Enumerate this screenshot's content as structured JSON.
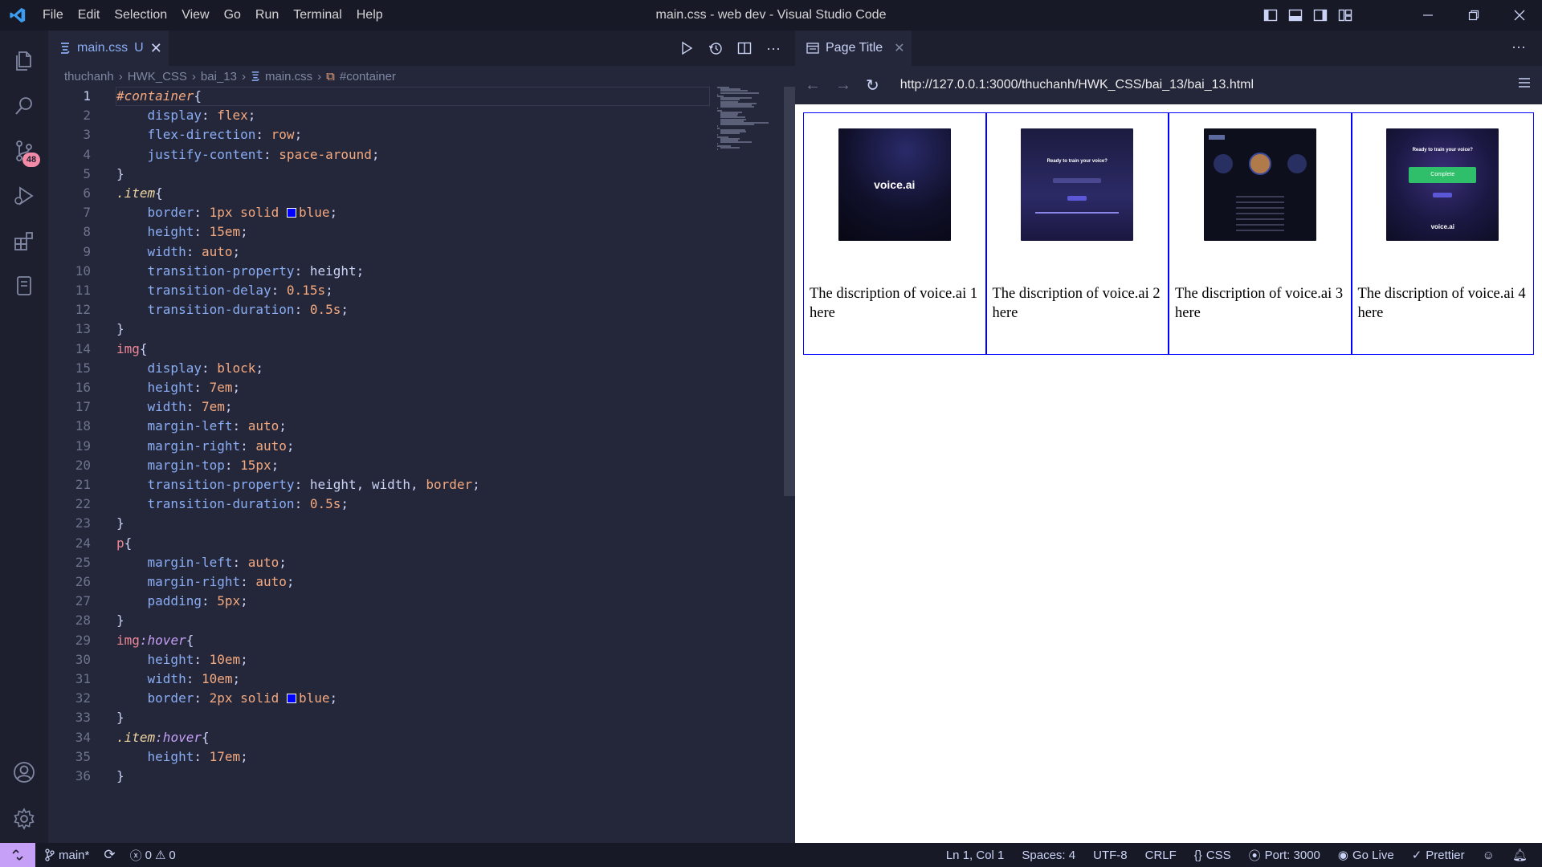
{
  "window": {
    "title": "main.css - web dev - Visual Studio Code",
    "menu": [
      "File",
      "Edit",
      "Selection",
      "View",
      "Go",
      "Run",
      "Terminal",
      "Help"
    ]
  },
  "activity_bar": {
    "source_control_badge": "48"
  },
  "editor": {
    "tab": {
      "name": "main.css",
      "status": "U",
      "close": "✕"
    },
    "breadcrumb": [
      "thuchanh",
      "HWK_CSS",
      "bai_13",
      "main.css",
      "#container"
    ],
    "lines": [
      [
        [
          "t-id",
          "#container"
        ],
        [
          "t-br",
          "{"
        ]
      ],
      [
        [
          "",
          "    "
        ],
        [
          "t-prop",
          "display"
        ],
        [
          "",
          ": "
        ],
        [
          "t-val",
          "flex"
        ],
        [
          "",
          ";"
        ]
      ],
      [
        [
          "",
          "    "
        ],
        [
          "t-prop",
          "flex-direction"
        ],
        [
          "",
          ": "
        ],
        [
          "t-val",
          "row"
        ],
        [
          "",
          ";"
        ]
      ],
      [
        [
          "",
          "    "
        ],
        [
          "t-prop",
          "justify-content"
        ],
        [
          "",
          ": "
        ],
        [
          "t-val",
          "space-around"
        ],
        [
          "",
          ";"
        ]
      ],
      [
        [
          "t-br",
          "}"
        ]
      ],
      [
        [
          "t-cls",
          ".item"
        ],
        [
          "t-br",
          "{"
        ]
      ],
      [
        [
          "",
          "    "
        ],
        [
          "t-prop",
          "border"
        ],
        [
          "",
          ": "
        ],
        [
          "t-num",
          "1px"
        ],
        [
          "",
          " "
        ],
        [
          "t-val",
          "solid"
        ],
        [
          "",
          " "
        ],
        [
          "swatch",
          ""
        ],
        [
          "t-val",
          "blue"
        ],
        [
          "",
          ";"
        ]
      ],
      [
        [
          "",
          "    "
        ],
        [
          "t-prop",
          "height"
        ],
        [
          "",
          ": "
        ],
        [
          "t-num",
          "15em"
        ],
        [
          "",
          ";"
        ]
      ],
      [
        [
          "",
          "    "
        ],
        [
          "t-prop",
          "width"
        ],
        [
          "",
          ": "
        ],
        [
          "t-val",
          "auto"
        ],
        [
          "",
          ";"
        ]
      ],
      [
        [
          "",
          "    "
        ],
        [
          "t-prop",
          "transition-property"
        ],
        [
          "",
          ": "
        ],
        [
          "",
          "height"
        ],
        [
          "",
          ";"
        ]
      ],
      [
        [
          "",
          "    "
        ],
        [
          "t-prop",
          "transition-delay"
        ],
        [
          "",
          ": "
        ],
        [
          "t-num",
          "0.15s"
        ],
        [
          "",
          ";"
        ]
      ],
      [
        [
          "",
          "    "
        ],
        [
          "t-prop",
          "transition-duration"
        ],
        [
          "",
          ": "
        ],
        [
          "t-num",
          "0.5s"
        ],
        [
          "",
          ";"
        ]
      ],
      [
        [
          "t-br",
          "}"
        ]
      ],
      [
        [
          "t-tag",
          "img"
        ],
        [
          "t-br",
          "{"
        ]
      ],
      [
        [
          "",
          "    "
        ],
        [
          "t-prop",
          "display"
        ],
        [
          "",
          ": "
        ],
        [
          "t-val",
          "block"
        ],
        [
          "",
          ";"
        ]
      ],
      [
        [
          "",
          "    "
        ],
        [
          "t-prop",
          "height"
        ],
        [
          "",
          ": "
        ],
        [
          "t-num",
          "7em"
        ],
        [
          "",
          ";"
        ]
      ],
      [
        [
          "",
          "    "
        ],
        [
          "t-prop",
          "width"
        ],
        [
          "",
          ": "
        ],
        [
          "t-num",
          "7em"
        ],
        [
          "",
          ";"
        ]
      ],
      [
        [
          "",
          "    "
        ],
        [
          "t-prop",
          "margin-left"
        ],
        [
          "",
          ": "
        ],
        [
          "t-val",
          "auto"
        ],
        [
          "",
          ";"
        ]
      ],
      [
        [
          "",
          "    "
        ],
        [
          "t-prop",
          "margin-right"
        ],
        [
          "",
          ": "
        ],
        [
          "t-val",
          "auto"
        ],
        [
          "",
          ";"
        ]
      ],
      [
        [
          "",
          "    "
        ],
        [
          "t-prop",
          "margin-top"
        ],
        [
          "",
          ": "
        ],
        [
          "t-num",
          "15px"
        ],
        [
          "",
          ";"
        ]
      ],
      [
        [
          "",
          "    "
        ],
        [
          "t-prop",
          "transition-property"
        ],
        [
          "",
          ": "
        ],
        [
          "",
          "height, width, "
        ],
        [
          "t-val",
          "border"
        ],
        [
          "",
          ";"
        ]
      ],
      [
        [
          "",
          "    "
        ],
        [
          "t-prop",
          "transition-duration"
        ],
        [
          "",
          ": "
        ],
        [
          "t-num",
          "0.5s"
        ],
        [
          "",
          ";"
        ]
      ],
      [
        [
          "t-br",
          "}"
        ]
      ],
      [
        [
          "t-tag",
          "p"
        ],
        [
          "t-br",
          "{"
        ]
      ],
      [
        [
          "",
          "    "
        ],
        [
          "t-prop",
          "margin-left"
        ],
        [
          "",
          ": "
        ],
        [
          "t-val",
          "auto"
        ],
        [
          "",
          ";"
        ]
      ],
      [
        [
          "",
          "    "
        ],
        [
          "t-prop",
          "margin-right"
        ],
        [
          "",
          ": "
        ],
        [
          "t-val",
          "auto"
        ],
        [
          "",
          ";"
        ]
      ],
      [
        [
          "",
          "    "
        ],
        [
          "t-prop",
          "padding"
        ],
        [
          "",
          ": "
        ],
        [
          "t-num",
          "5px"
        ],
        [
          "",
          ";"
        ]
      ],
      [
        [
          "t-br",
          "}"
        ]
      ],
      [
        [
          "t-tag",
          "img"
        ],
        [
          "t-pc",
          ":hover"
        ],
        [
          "t-br",
          "{"
        ]
      ],
      [
        [
          "",
          "    "
        ],
        [
          "t-prop",
          "height"
        ],
        [
          "",
          ": "
        ],
        [
          "t-num",
          "10em"
        ],
        [
          "",
          ";"
        ]
      ],
      [
        [
          "",
          "    "
        ],
        [
          "t-prop",
          "width"
        ],
        [
          "",
          ": "
        ],
        [
          "t-num",
          "10em"
        ],
        [
          "",
          ";"
        ]
      ],
      [
        [
          "",
          "    "
        ],
        [
          "t-prop",
          "border"
        ],
        [
          "",
          ": "
        ],
        [
          "t-num",
          "2px"
        ],
        [
          "",
          " "
        ],
        [
          "t-val",
          "solid"
        ],
        [
          "",
          " "
        ],
        [
          "swatch",
          ""
        ],
        [
          "t-val",
          "blue"
        ],
        [
          "",
          ";"
        ]
      ],
      [
        [
          "t-br",
          "}"
        ]
      ],
      [
        [
          "t-cls",
          ".item"
        ],
        [
          "t-pc",
          ":hover"
        ],
        [
          "t-br",
          "{"
        ]
      ],
      [
        [
          "",
          "    "
        ],
        [
          "t-prop",
          "height"
        ],
        [
          "",
          ": "
        ],
        [
          "t-num",
          "17em"
        ],
        [
          "",
          ";"
        ]
      ],
      [
        [
          "t-br",
          "}"
        ]
      ]
    ]
  },
  "preview": {
    "tab_title": "Page Title",
    "url": "http://127.0.0.1:3000/thuchanh/HWK_CSS/bai_13/bai_13.html",
    "items": [
      {
        "caption": "The discription of voice.ai 1 here",
        "logo": "voice.ai"
      },
      {
        "caption": "The discription of voice.ai 2 here",
        "heading": "Ready to train your voice?"
      },
      {
        "caption": "The discription of voice.ai 3 here"
      },
      {
        "caption": "The discription of voice.ai 4 here",
        "heading": "Ready to train your voice?",
        "button": "Complete",
        "logo": "voice.ai"
      }
    ]
  },
  "status_bar": {
    "branch": "main*",
    "errors": "0",
    "warnings": "0",
    "position": "Ln 1, Col 1",
    "spaces": "Spaces: 4",
    "encoding": "UTF-8",
    "eol": "CRLF",
    "language": "CSS",
    "port": "Port: 3000",
    "golive": "Go Live",
    "prettier": "Prettier"
  },
  "colors": {
    "accent": "#c6a0f6",
    "item_border": "#0000ff",
    "tab_label": "#8aadf4"
  }
}
